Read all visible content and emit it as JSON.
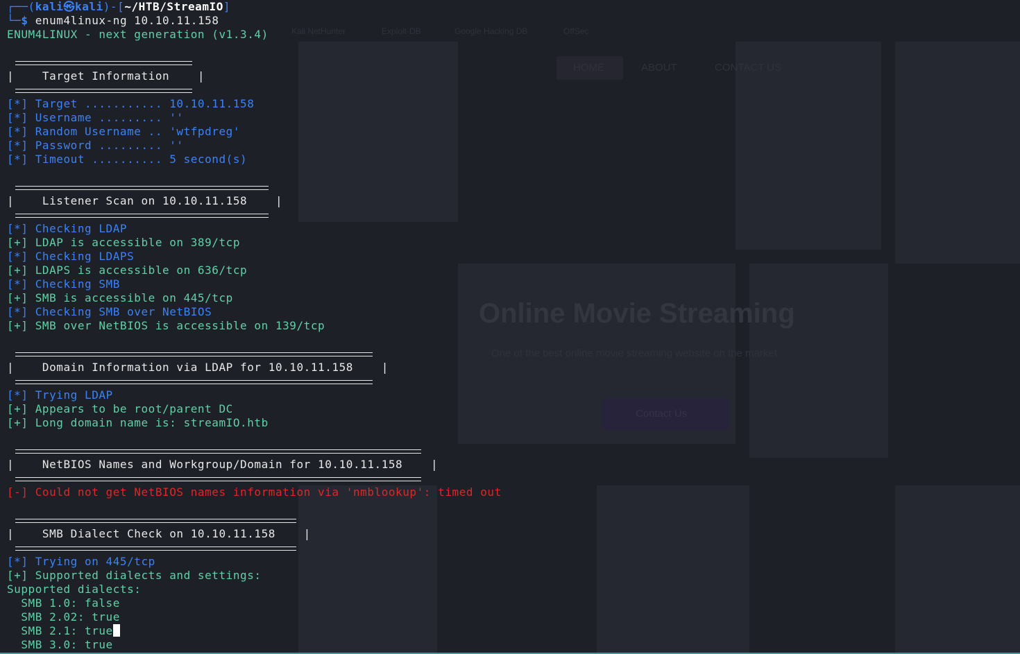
{
  "prompt": {
    "open": "┌──(",
    "user": "kali㉿kali",
    "mid": ")-[",
    "path": "~/HTB/StreamIO",
    "close": "]",
    "second_prefix": "└─",
    "dollar": "$ ",
    "command": "enum4linux-ng 10.10.11.158"
  },
  "banner": "ENUM4LINUX - next generation (v1.3.4)",
  "sections": {
    "target": {
      "title": "|    Target Information    |",
      "lines": [
        "[*] Target ........... 10.10.11.158",
        "[*] Username ......... ''",
        "[*] Random Username .. 'wtfpdreg'",
        "[*] Password ......... ''",
        "[*] Timeout .......... 5 second(s)"
      ]
    },
    "listener": {
      "title": "|    Listener Scan on 10.10.11.158    |",
      "lines": [
        "[*] Checking LDAP",
        "[+] LDAP is accessible on 389/tcp",
        "[*] Checking LDAPS",
        "[+] LDAPS is accessible on 636/tcp",
        "[*] Checking SMB",
        "[+] SMB is accessible on 445/tcp",
        "[*] Checking SMB over NetBIOS",
        "[+] SMB over NetBIOS is accessible on 139/tcp"
      ]
    },
    "domain": {
      "title": "|    Domain Information via LDAP for 10.10.11.158    |",
      "lines": [
        "[*] Trying LDAP",
        "[+] Appears to be root/parent DC",
        "[+] Long domain name is: streamIO.htb"
      ]
    },
    "netbios": {
      "title": "|    NetBIOS Names and Workgroup/Domain for 10.10.11.158    |",
      "lines": [
        "[-] Could not get NetBIOS names information via 'nmblookup': timed out"
      ]
    },
    "dialect": {
      "title": "|    SMB Dialect Check on 10.10.11.158    |",
      "lines": [
        "[*] Trying on 445/tcp",
        "[+] Supported dialects and settings:",
        "Supported dialects:",
        "  SMB 1.0: false",
        "  SMB 2.02: true",
        "  SMB 2.1: true",
        "  SMB 3.0: true"
      ]
    }
  },
  "background_site": {
    "nav": [
      "HOME",
      "ABOUT",
      "CONTACT US"
    ],
    "bookmarks": [
      "Kali NetHunter",
      "Exploit-DB",
      "Google Hacking DB",
      "OffSec"
    ],
    "hero_title": "Online Movie Streaming",
    "hero_subtitle": "One of the best online movie streaming website on the market",
    "hero_button": "Contact Us"
  },
  "colors": {
    "info": "#3b82f6",
    "success": "#61d0a6",
    "error": "#e02626",
    "background": "#1e2028"
  }
}
